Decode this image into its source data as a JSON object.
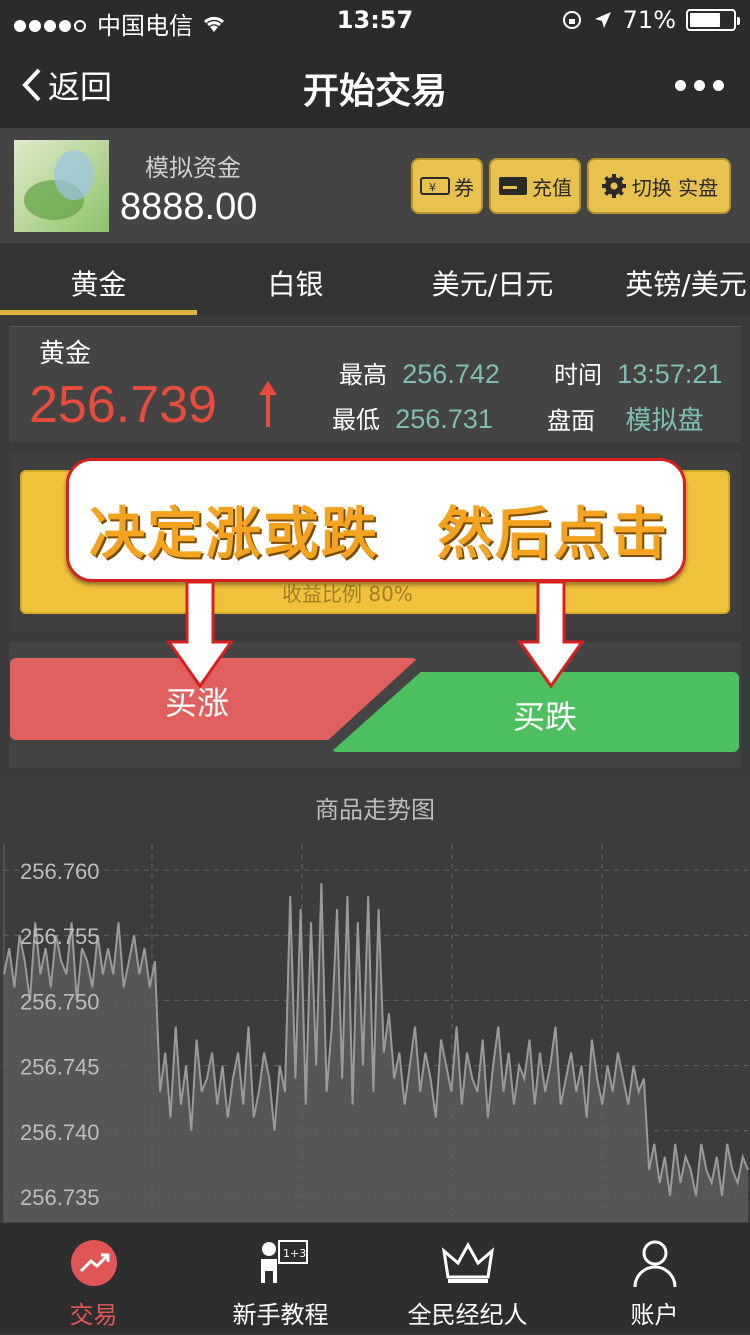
{
  "status_bar": {
    "carrier": "中国电信",
    "time": "13:57",
    "battery": "71%"
  },
  "nav": {
    "back_label": "返回",
    "title": "开始交易"
  },
  "account": {
    "label": "模拟资金",
    "balance": "8888.00",
    "buttons": {
      "coupon": "券",
      "recharge": "充值",
      "switch": "切换 实盘"
    }
  },
  "tabs": [
    {
      "label": "黄金"
    },
    {
      "label": "白银"
    },
    {
      "label": "美元/日元"
    },
    {
      "label": "英镑/美元"
    }
  ],
  "quote": {
    "name": "黄金",
    "price": "256.739",
    "high_label": "最高",
    "high": "256.742",
    "low_label": "最低",
    "low": "256.731",
    "time_label": "时间",
    "time": "13:57:21",
    "board_label": "盘面",
    "board": "模拟盘"
  },
  "panel": {
    "under_text": "收益比例 80%"
  },
  "callout": {
    "text": "决定涨或跌　然后点击"
  },
  "trade": {
    "buy_up": "买涨",
    "buy_down": "买跌"
  },
  "chart_data": {
    "type": "line",
    "title": "商品走势图",
    "yticks": [
      "256.760",
      "256.755",
      "256.750",
      "256.745",
      "256.740",
      "256.735"
    ],
    "ylim": [
      256.733,
      256.762
    ],
    "grid": true,
    "series": [
      {
        "values": [
          256.752,
          256.754,
          256.751,
          256.755,
          256.753,
          256.75,
          256.756,
          256.752,
          256.754,
          256.751,
          256.755,
          256.753,
          256.752,
          256.756,
          256.75,
          256.754,
          256.753,
          256.751,
          256.755,
          256.752,
          256.754,
          256.752,
          256.756,
          256.751,
          256.753,
          256.755,
          256.752,
          256.754,
          256.751,
          256.753,
          256.743,
          256.746,
          256.741,
          256.748,
          256.742,
          256.745,
          256.74,
          256.747,
          256.743,
          256.744,
          256.746,
          256.742,
          256.745,
          256.741,
          256.744,
          256.746,
          256.742,
          256.748,
          256.741,
          256.743,
          256.746,
          256.744,
          256.74,
          256.745,
          256.743,
          256.758,
          256.744,
          256.757,
          256.742,
          256.756,
          256.745,
          256.759,
          256.743,
          256.748,
          256.757,
          256.744,
          256.758,
          256.742,
          256.756,
          256.745,
          256.758,
          256.743,
          256.757,
          256.746,
          256.749,
          256.744,
          256.746,
          256.742,
          256.745,
          256.748,
          256.743,
          256.746,
          256.744,
          256.741,
          256.747,
          256.745,
          256.743,
          256.748,
          256.742,
          256.746,
          256.744,
          256.743,
          256.747,
          256.741,
          256.745,
          256.748,
          256.743,
          256.746,
          256.742,
          256.745,
          256.744,
          256.747,
          256.742,
          256.746,
          256.743,
          256.745,
          256.748,
          256.742,
          256.744,
          256.746,
          256.743,
          256.745,
          256.741,
          256.747,
          256.744,
          256.742,
          256.745,
          256.743,
          256.746,
          256.744,
          256.742,
          256.745,
          256.743,
          256.744,
          256.737,
          256.739,
          256.736,
          256.738,
          256.735,
          256.739,
          256.736,
          256.738,
          256.737,
          256.735,
          256.739,
          256.737,
          256.736,
          256.738,
          256.735,
          256.739,
          256.737,
          256.736,
          256.738,
          256.737
        ]
      }
    ]
  },
  "bottom_nav": [
    {
      "label": "交易",
      "icon": "trend-up-icon"
    },
    {
      "label": "新手教程",
      "icon": "teacher-icon"
    },
    {
      "label": "全民经纪人",
      "icon": "crown-icon"
    },
    {
      "label": "账户",
      "icon": "user-icon"
    }
  ],
  "colors": {
    "accent": "#e8c14e",
    "up": "#e06060",
    "down": "#4cbf5f",
    "price": "#e74c3c",
    "quote_value": "#7fbfb1",
    "callout_text": "#f3a320"
  }
}
